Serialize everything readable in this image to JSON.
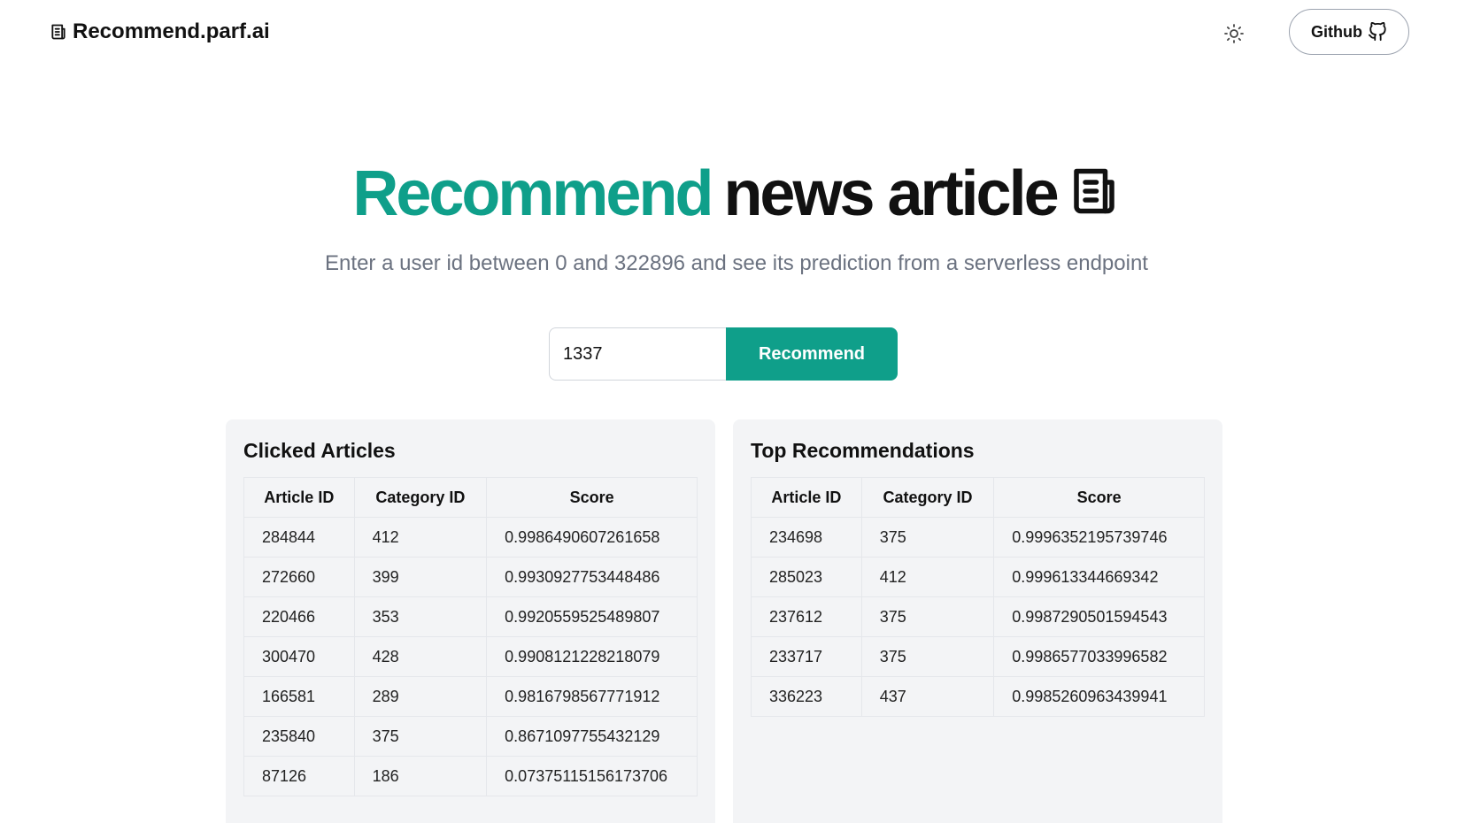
{
  "header": {
    "brand": "Recommend.parf.ai",
    "github_label": "Github"
  },
  "hero": {
    "title_accent": "Recommend",
    "title_rest": "news article",
    "subtitle": "Enter a user id between 0 and 322896 and see its prediction from a serverless endpoint"
  },
  "search": {
    "value": "1337",
    "button_label": "Recommend"
  },
  "clicked": {
    "title": "Clicked Articles",
    "columns": [
      "Article ID",
      "Category ID",
      "Score"
    ],
    "rows": [
      [
        "284844",
        "412",
        "0.9986490607261658"
      ],
      [
        "272660",
        "399",
        "0.9930927753448486"
      ],
      [
        "220466",
        "353",
        "0.9920559525489807"
      ],
      [
        "300470",
        "428",
        "0.9908121228218079"
      ],
      [
        "166581",
        "289",
        "0.9816798567771912"
      ],
      [
        "235840",
        "375",
        "0.8671097755432129"
      ],
      [
        "87126",
        "186",
        "0.07375115156173706"
      ]
    ]
  },
  "recommendations": {
    "title": "Top Recommendations",
    "columns": [
      "Article ID",
      "Category ID",
      "Score"
    ],
    "rows": [
      [
        "234698",
        "375",
        "0.9996352195739746"
      ],
      [
        "285023",
        "412",
        "0.999613344669342"
      ],
      [
        "237612",
        "375",
        "0.9987290501594543"
      ],
      [
        "233717",
        "375",
        "0.9986577033996582"
      ],
      [
        "336223",
        "437",
        "0.9985260963439941"
      ]
    ]
  },
  "colors": {
    "accent": "#0f9f8a",
    "card_bg": "#f3f4f6"
  },
  "icons": [
    "newspaper-icon",
    "sun-icon",
    "github-icon"
  ]
}
